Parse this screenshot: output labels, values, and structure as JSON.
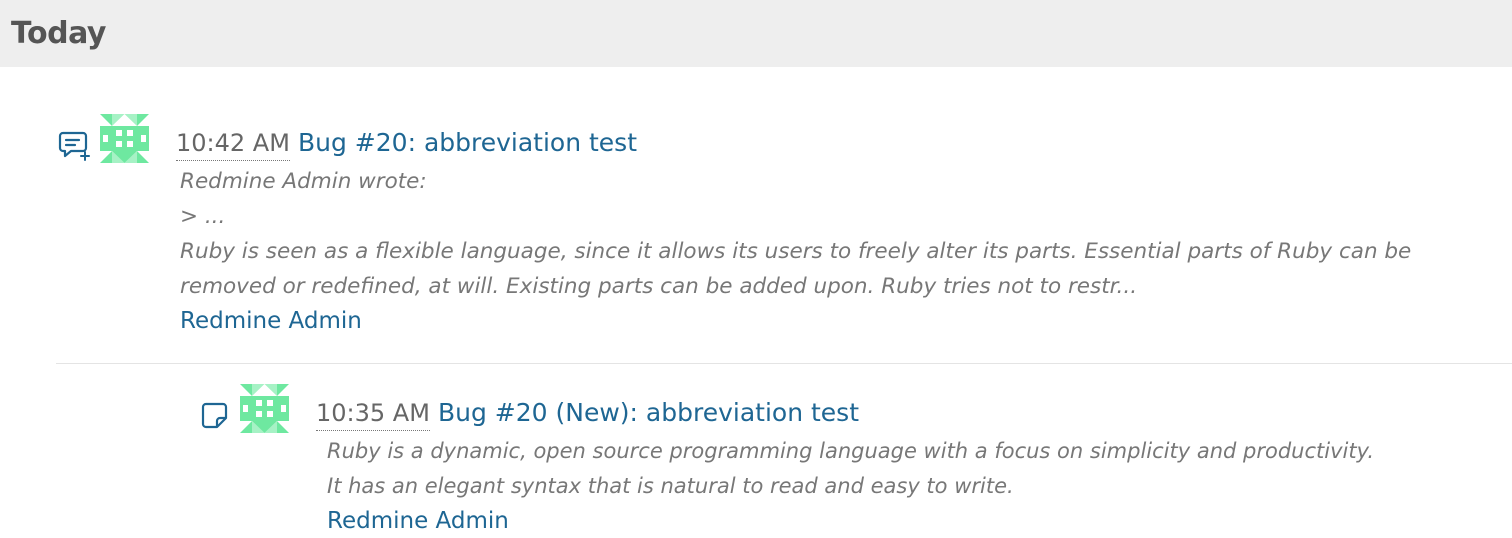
{
  "day_header": {
    "title": "Today"
  },
  "colors": {
    "link": "#1e6693",
    "muted_text": "#777777",
    "header_bg": "#eeeeee",
    "header_text": "#555555",
    "avatar_green": "#6ee8a0"
  },
  "events": [
    {
      "type_icon": "comment-add-icon",
      "avatar_icon": "identicon-avatar",
      "time": "10:42 AM",
      "title": "Bug #20: abbreviation test",
      "description_lines": [
        "Redmine Admin wrote:",
        "> ...",
        "Ruby is seen as a flexible language, since it allows its users to freely alter its parts. Essential parts of Ruby can be",
        "removed or redefined, at will. Existing parts can be added upon. Ruby tries not to restr..."
      ],
      "author": "Redmine Admin"
    },
    {
      "type_icon": "issue-note-icon",
      "avatar_icon": "identicon-avatar",
      "time": "10:35 AM",
      "title": "Bug #20 (New): abbreviation test",
      "description_lines": [
        "Ruby is a dynamic, open source programming language with a focus on simplicity and productivity.",
        "It has an elegant syntax that is natural to read and easy to write."
      ],
      "author": "Redmine Admin"
    }
  ]
}
